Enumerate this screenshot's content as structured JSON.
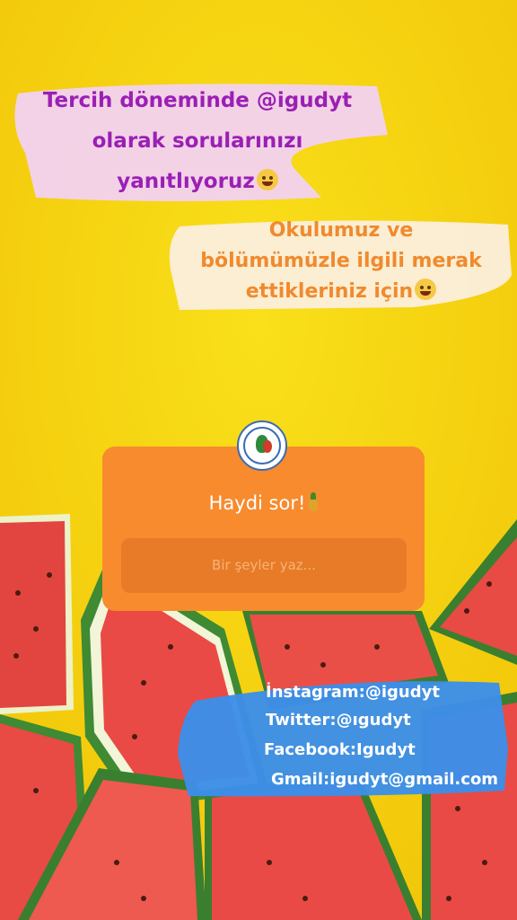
{
  "captions": {
    "line1": "Tercih döneminde @igudyt",
    "line2": "olarak sorularınızı",
    "line3": "yanıtlıyoruz",
    "line4": "Okulumuz ve",
    "line5": "bölümümüzle ilgili merak",
    "line6": "ettikleriniz için"
  },
  "question_sticker": {
    "prompt": "Haydi sor!",
    "placeholder": "Bir şeyler yaz..."
  },
  "social": {
    "instagram": "İnstagram:@igudyt",
    "twitter": "Twitter:@ıgudyt",
    "facebook": "Facebook:Igudyt",
    "gmail": "Gmail:igudyt@gmail.com"
  },
  "colors": {
    "background": "#f6d40e",
    "card": "#f78b2e",
    "field": "#e87b27",
    "caption_purple": "#9b1fb5",
    "caption_orange": "#f08a2e",
    "social_brush": "#3d8ee8"
  },
  "icons": [
    "smiling-face-emoji-icon",
    "star-struck-emoji-icon",
    "pineapple-emoji-icon",
    "school-logo-icon"
  ]
}
